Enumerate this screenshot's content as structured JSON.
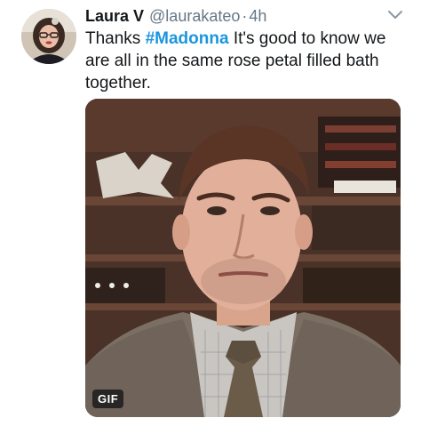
{
  "tweet": {
    "display_name": "Laura V",
    "handle": "@laurakateo",
    "separator": "·",
    "timestamp": "4h",
    "text_before": "Thanks ",
    "hashtag": "#Madonna",
    "text_after": " It's good to know we are all in the same rose petal filled bath together."
  },
  "media": {
    "badge": "GIF"
  },
  "icons": {
    "caret": "chevron-down-icon"
  },
  "colors": {
    "link": "#1b95e0",
    "secondary": "#657786",
    "primary_text": "#14171a"
  }
}
